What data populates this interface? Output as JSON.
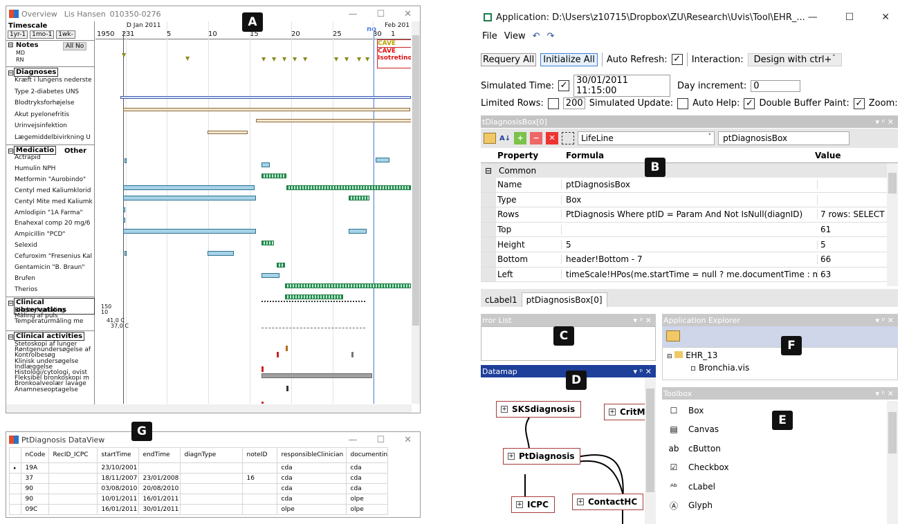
{
  "badges": {
    "a": "A",
    "b": "B",
    "c": "C",
    "d": "D",
    "e": "E",
    "f": "F",
    "g": "G"
  },
  "overview": {
    "title": "Overview",
    "patient": "Lis Hansen",
    "patient_id": "010350-0276",
    "timescale_label": "Timescale",
    "buttons": [
      "1yr-1",
      "1mo-1",
      "1wk-"
    ],
    "top_ticks": [
      "1950",
      "D Jan 2011",
      "Feb 201"
    ],
    "ticks": [
      "2",
      "3",
      "1",
      "5",
      "10",
      "15",
      "20",
      "25",
      "30",
      "1"
    ],
    "cursor_label": "no",
    "notes_label": "Notes",
    "all_no_label": "All No",
    "md_label": "MD",
    "rn_label": "RN",
    "cave1": "CAVE",
    "cave2": "CAVE",
    "cave3": "Isotretino",
    "diagnoses_label": "Diagnoses",
    "diagnoses": [
      "Kræft i lungens nederste",
      "Type 2-diabetes UNS",
      "Blodtryksforhøjelse",
      "Akut pyelonefritis",
      "Urinvejsinfektion",
      "Lægemiddelbivirkning U"
    ],
    "medication_label": "Medicatio",
    "other_label": "Other",
    "medications": [
      "Actrapid",
      "Humulin NPH",
      "Metformin \"Aurobindo\"",
      "Centyl med Kaliumklorid",
      "Centyl Mite med Kaliumk",
      "Amlodipin \"1A Farma\"",
      "Enahexal comp 20 mg/6",
      "Ampicillin \"PCD\"",
      "Selexid",
      "Cefuroxim \"Fresenius Kal",
      "Gentamicin \"B. Braun\"",
      "Brufen",
      "Therios"
    ],
    "clinobs_label": "Clinical observations",
    "clinobs": [
      "Blodtryksmåling",
      "Måling af puls",
      "Temperaturmåling me"
    ],
    "obs_scale": [
      "150",
      "10",
      "41,0 C",
      "37,0 C"
    ],
    "clinact_label": "Clinical activities",
    "clinact": [
      "Stetoskopi af lunger",
      "Røntgenundersøgelse af",
      "Kontrolbesøg",
      "Klinisk undersøgelse",
      "Indlæggelse",
      "Histologi/cytologi, ovist",
      "Fleksibel bronkoskopi m",
      "Bronkoalveolær lavage",
      "Anamneseoptagelse"
    ]
  },
  "dataview": {
    "title": "PtDiagnosis DataView",
    "columns": [
      "nCode",
      "RecID_ICPC",
      "startTime",
      "endTime",
      "diagnType",
      "noteID",
      "responsibleClinician",
      "documentingUse"
    ],
    "rows": [
      [
        "19A",
        "",
        "23/10/2001",
        "",
        "",
        "",
        "cda",
        "cda"
      ],
      [
        "37",
        "",
        "18/11/2007",
        "23/01/2008",
        "",
        "16",
        "cda",
        "cda"
      ],
      [
        "90",
        "",
        "03/08/2010",
        "20/08/2010",
        "",
        "",
        "cda",
        "cda"
      ],
      [
        "90",
        "",
        "10/01/2011",
        "16/01/2011",
        "",
        "",
        "cda",
        "olpe"
      ],
      [
        "09C",
        "",
        "16/01/2011",
        "30/01/2011",
        "",
        "",
        "olpe",
        "olpe"
      ]
    ]
  },
  "app": {
    "title": "Application: D:\\Users\\z10715\\Dropbox\\ZU\\Research\\Uvis\\Tool\\EHR_...",
    "menu": [
      "File",
      "View"
    ],
    "requery": "Requery All",
    "initialize": "Initialize All",
    "auto_refresh": "Auto Refresh:",
    "interaction": "Interaction:",
    "interaction_value": "Design with ctrl+",
    "sim_time_label": "Simulated Time:",
    "sim_time_value": "30/01/2011 11:15:00",
    "day_inc_label": "Day increment:",
    "day_inc_value": "0",
    "limited_rows": "Limited Rows:",
    "limited_rows_value": "200",
    "sim_update": "Simulated Update:",
    "auto_help": "Auto Help:",
    "double_buffer": "Double Buffer Paint:",
    "zoom": "Zoom:",
    "zoom_value": "1",
    "prop_panel_title": "tDiagnosisBox[0]",
    "control_type": "LifeLine",
    "control_name": "ptDiagnosisBox",
    "col_property": "Property",
    "col_formula": "Formula",
    "col_value": "Value",
    "group": "Common",
    "props": [
      [
        "Name",
        "ptDiagnosisBox",
        ""
      ],
      [
        "Type",
        "Box",
        ""
      ],
      [
        "Rows",
        "PtDiagnosis Where ptID = Param And Not IsNull(diagnID)",
        "7 rows: SELECT"
      ],
      [
        "Top",
        "",
        "61"
      ],
      [
        "Height",
        "5",
        "5"
      ],
      [
        "Bottom",
        "header!Bottom - 7",
        "66"
      ],
      [
        "Left",
        "timeScale!HPos(me.startTime = null ? me.documentTime : me.startTime)",
        "63"
      ]
    ],
    "tabs": [
      "cLabel1",
      "ptDiagnosisBox[0]"
    ],
    "error_list": "rror List",
    "app_explorer": "Application Explorer",
    "tree_root": "EHR_13",
    "tree_child": "Bronchia.vis",
    "datamap": "Datamap",
    "nodes": [
      "SKSdiagnosis",
      "CritM",
      "PtDiagnosis",
      "ICPC",
      "ContactHC"
    ],
    "toolbox": "Toolbox",
    "tools": [
      {
        "label": "Box",
        "icon": "box-icon"
      },
      {
        "label": "Canvas",
        "icon": "canvas-icon"
      },
      {
        "label": "cButton",
        "icon": "button-icon"
      },
      {
        "label": "Checkbox",
        "icon": "checkbox-icon"
      },
      {
        "label": "cLabel",
        "icon": "label-icon"
      },
      {
        "label": "Glyph",
        "icon": "glyph-icon"
      }
    ]
  }
}
